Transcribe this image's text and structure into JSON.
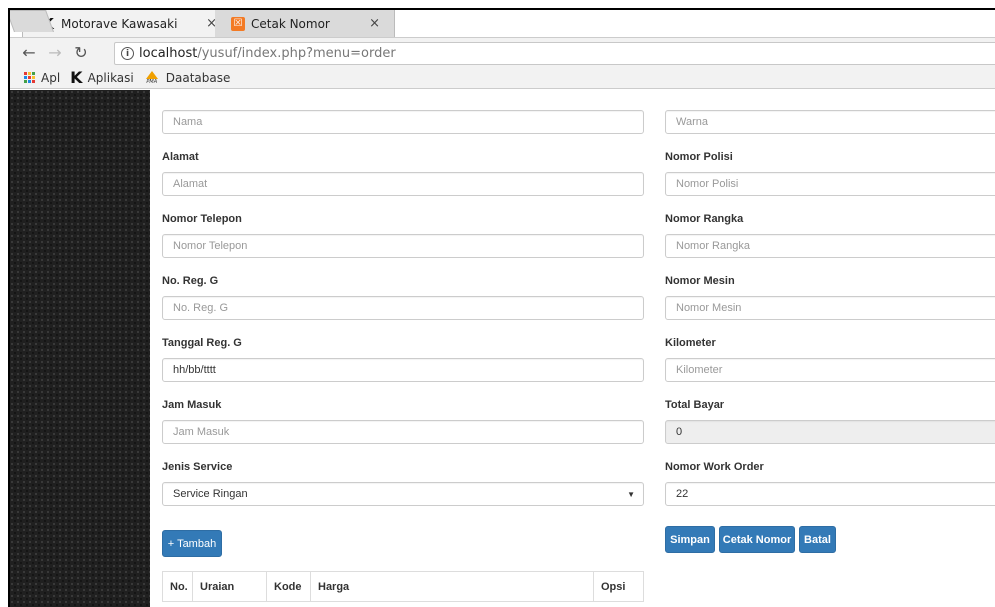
{
  "browser": {
    "tabs": [
      {
        "title": "Motorave Kawasaki",
        "icon": "kawasaki-k-icon"
      },
      {
        "title": "Cetak Nomor",
        "icon": "xampp-icon"
      }
    ],
    "tab_close_symbol": "×",
    "url_host": "localhost",
    "url_path": "/yusuf/index.php?menu=order",
    "bookmarks": [
      {
        "label": "Apl",
        "icon": "apps-grid-icon"
      },
      {
        "label": "Aplikasi",
        "icon": "kawasaki-k-icon"
      },
      {
        "label": "Daatabase",
        "icon": "phpmyadmin-icon"
      }
    ],
    "pma_icon_text": "PMA"
  },
  "form": {
    "left": [
      {
        "label": "",
        "placeholder": "Nama",
        "value": ""
      },
      {
        "label": "Alamat",
        "placeholder": "Alamat",
        "value": ""
      },
      {
        "label": "Nomor Telepon",
        "placeholder": "Nomor Telepon",
        "value": ""
      },
      {
        "label": "No. Reg. G",
        "placeholder": "No. Reg. G",
        "value": ""
      },
      {
        "label": "Tanggal Reg. G",
        "placeholder": "",
        "value": "hh/bb/tttt"
      },
      {
        "label": "Jam Masuk",
        "placeholder": "Jam Masuk",
        "value": ""
      },
      {
        "label": "Jenis Service",
        "placeholder": "",
        "value": "Service Ringan"
      }
    ],
    "right": [
      {
        "label": "",
        "placeholder": "Warna",
        "value": ""
      },
      {
        "label": "Nomor Polisi",
        "placeholder": "Nomor Polisi",
        "value": ""
      },
      {
        "label": "Nomor Rangka",
        "placeholder": "Nomor Rangka",
        "value": ""
      },
      {
        "label": "Nomor Mesin",
        "placeholder": "Nomor Mesin",
        "value": ""
      },
      {
        "label": "Kilometer",
        "placeholder": "Kilometer",
        "value": ""
      },
      {
        "label": "Total Bayar",
        "placeholder": "",
        "value": "0"
      },
      {
        "label": "Nomor Work Order",
        "placeholder": "",
        "value": "22"
      }
    ],
    "buttons": {
      "tambah": "+ Tambah",
      "simpan": "Simpan",
      "cetak": "Cetak Nomor",
      "batal": "Batal"
    },
    "table_headers": [
      "No.",
      "Uraian",
      "Kode",
      "Harga",
      "Opsi"
    ]
  },
  "colors": {
    "primary_button": "#337ab7",
    "sidebar": "#202020"
  }
}
